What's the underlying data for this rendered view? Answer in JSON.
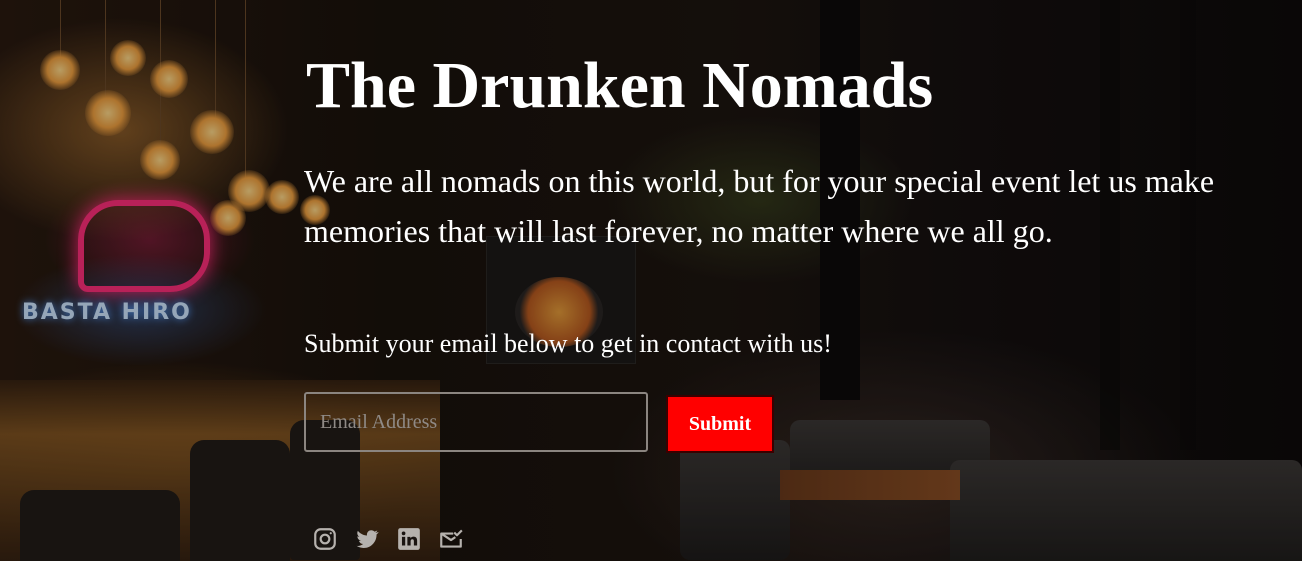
{
  "hero": {
    "title": "The Drunken Nomads",
    "tagline": "We are all nomads on this world, but for your special event let us make memories that will last forever, no matter where we all go.",
    "cta_text": "Submit your email below to get in contact with us!"
  },
  "form": {
    "email_placeholder": "Email Address",
    "submit_label": "Submit"
  },
  "social": {
    "icons": [
      "instagram-icon",
      "twitter-icon",
      "linkedin-icon",
      "mail-check-icon"
    ]
  },
  "colors": {
    "submit_background": "#ff0000",
    "text": "#ffffff",
    "social_icon": "#b6b2ae"
  }
}
